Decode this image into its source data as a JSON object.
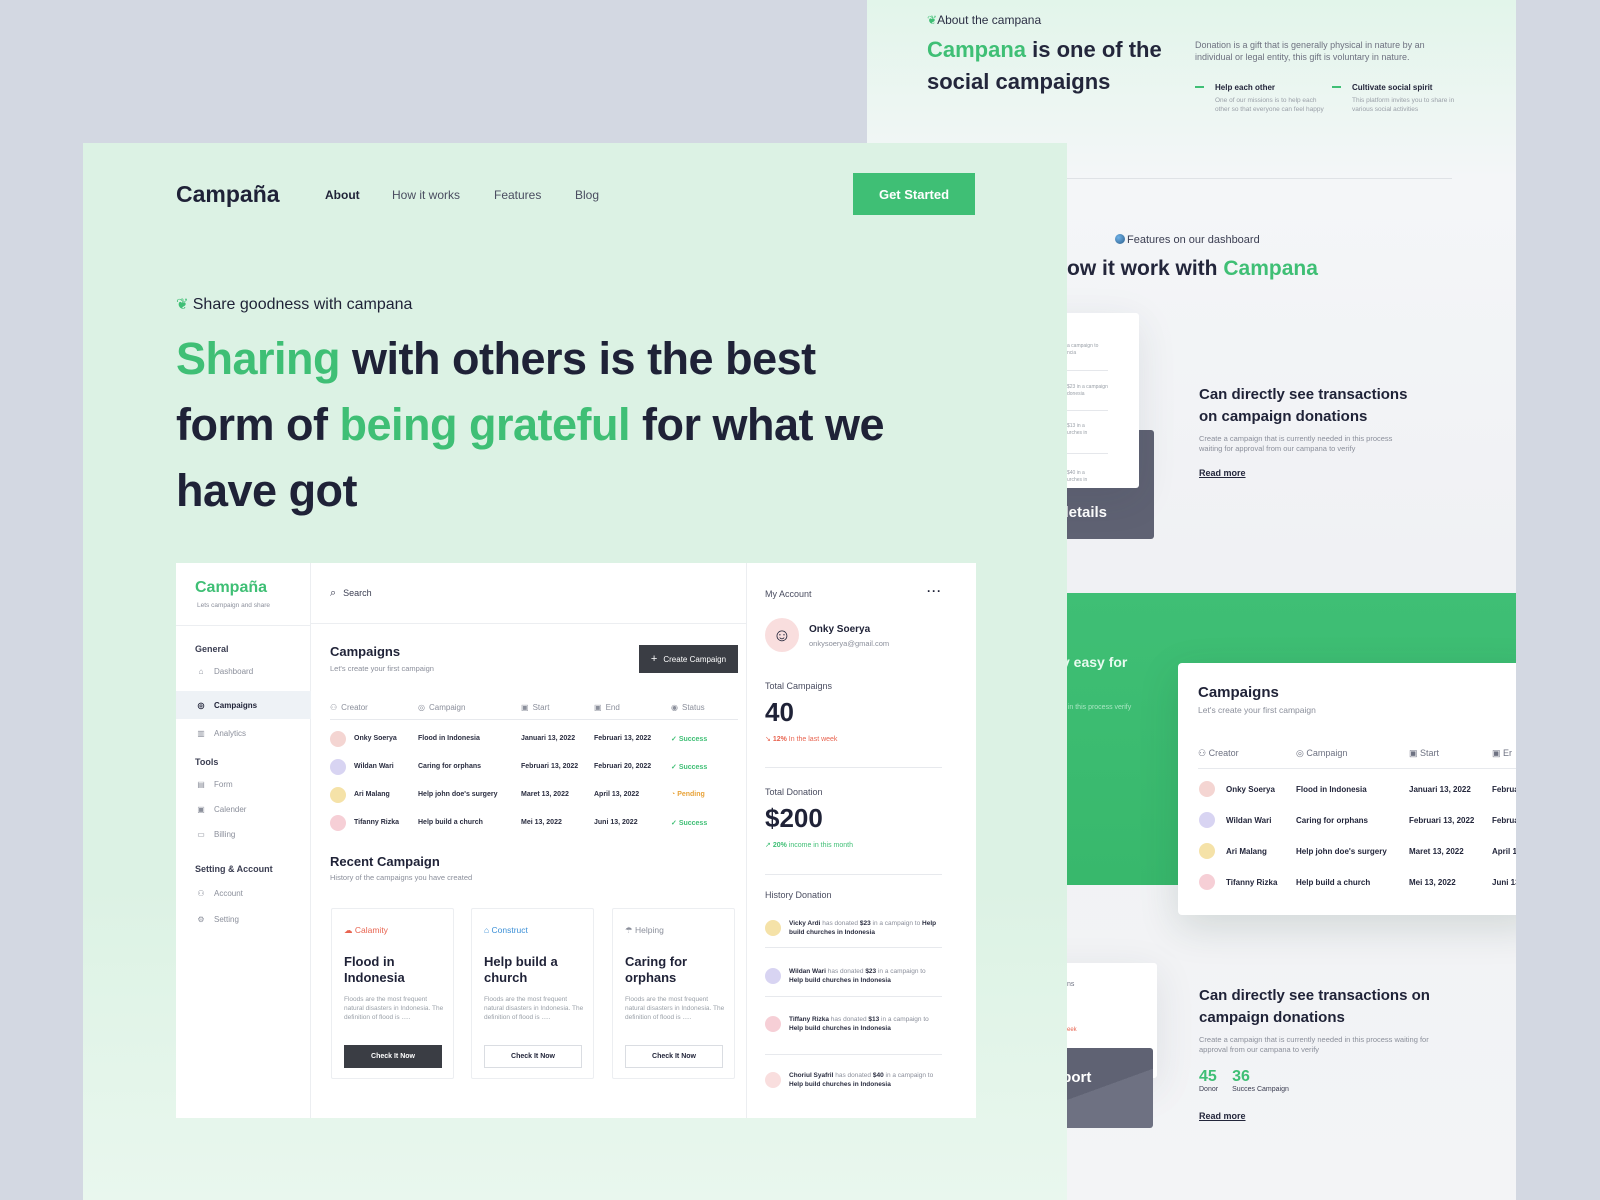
{
  "back": {
    "about_tag": "About the campana",
    "about_title_brand": "Campana",
    "about_title_rest": " is one of the social campaigns",
    "about_desc": "Donation is a gift that is generally physical in nature by an individual or legal entity, this gift is voluntary in nature.",
    "features": [
      {
        "title": "Help each other",
        "desc": "One of our missions is to help each other so that everyone can feel happy"
      },
      {
        "title": "Cultivate social spirit",
        "desc": "This platform invites you to share in various social activities"
      }
    ],
    "dashboard_tag": "Features on our dashboard",
    "dashboard_title_a": "ow it work with ",
    "dashboard_title_brand": "Campana",
    "dark_card_1": "on details",
    "mini_lines": [
      "a campaign to",
      "ncia",
      "$23 in a campaign",
      "donesia",
      "$13 in a",
      "urches in",
      "$40 in a",
      "urches in"
    ],
    "section1": {
      "title": "Can directly see transactions on campaign donations",
      "desc": "Create a campaign that is currently needed in this process waiting for approval from our campana to verify",
      "readmore": "Read more"
    },
    "band_text": "y easy for",
    "band_sub": "d in this process verify",
    "campaigns": {
      "title": "Campaigns",
      "sub": "Let's create your first campaign",
      "headers": [
        "Creator",
        "Campaign",
        "Start",
        "Er"
      ],
      "rows": [
        {
          "creator": "Onky Soerya",
          "campaign": "Flood in Indonesia",
          "start": "Januari 13, 2022",
          "end": "Februa"
        },
        {
          "creator": "Wildan Wari",
          "campaign": "Caring for orphans",
          "start": "Februari 13, 2022",
          "end": "Februa"
        },
        {
          "creator": "Ari Malang",
          "campaign": "Help john doe's surgery",
          "start": "Maret 13, 2022",
          "end": "April 1"
        },
        {
          "creator": "Tifanny Rizka",
          "campaign": "Help build a church",
          "start": "Mei 13, 2022",
          "end": "Juni 13"
        }
      ]
    },
    "report_card": "Report",
    "report_peek_1": "ns",
    "report_peek_2": "eek",
    "section2": {
      "title": "Can directly see transactions on campaign donations",
      "desc": "Create a campaign that is currently needed in this process waiting for approval from our campana to verify",
      "stat1_value": "45",
      "stat1_label": "Donor",
      "stat2_value": "36",
      "stat2_label": "Succes Campaign",
      "readmore": "Read more"
    }
  },
  "front": {
    "logo": "Campaña",
    "nav": [
      "About",
      "How it works",
      "Features",
      "Blog"
    ],
    "cta": "Get Started",
    "hero_tag": "Share goodness with campana",
    "hero": {
      "p1": "Sharing",
      "p2": " with others is the best form of ",
      "p3": "being grateful",
      "p4": " for what we have got"
    }
  },
  "dashboard": {
    "logo": "Campaña",
    "logo_sub": "Lets campaign and share",
    "groups": [
      {
        "title": "General",
        "items": [
          "Dashboard",
          "Campaigns",
          "Analytics"
        ]
      },
      {
        "title": "Tools",
        "items": [
          "Form",
          "Calender",
          "Billing"
        ]
      },
      {
        "title": "Setting & Account",
        "items": [
          "Account",
          "Setting"
        ]
      }
    ],
    "search_placeholder": "Search",
    "campaigns_title": "Campaigns",
    "campaigns_sub": "Let's create your first campaign",
    "create_button": "Create Campaign",
    "table_headers": [
      "Creator",
      "Campaign",
      "Start",
      "End",
      "Status"
    ],
    "rows": [
      {
        "creator": "Onky Soerya",
        "campaign": "Flood in Indonesia",
        "start": "Januari 13, 2022",
        "end": "Februari 13, 2022",
        "status": "Success"
      },
      {
        "creator": "Wildan Wari",
        "campaign": "Caring for orphans",
        "start": "Februari 13, 2022",
        "end": "Februari 20, 2022",
        "status": "Success"
      },
      {
        "creator": "Ari Malang",
        "campaign": "Help john doe's surgery",
        "start": "Maret 13, 2022",
        "end": "April 13, 2022",
        "status": "Pending"
      },
      {
        "creator": "Tifanny Rizka",
        "campaign": "Help build a church",
        "start": "Mei 13, 2022",
        "end": "Juni 13, 2022",
        "status": "Success"
      }
    ],
    "recent_title": "Recent Campaign",
    "recent_sub": "History of the campaigns you have created",
    "recent_cards": [
      {
        "category": "Calamity",
        "title": "Flood in Indonesia",
        "desc": "Floods are the most frequent natural disasters in Indonesia. The definition of flood is .....",
        "button": "Check It Now"
      },
      {
        "category": "Construct",
        "title": "Help build a church",
        "desc": "Floods are the most frequent natural disasters in Indonesia. The definition of flood is .....",
        "button": "Check It Now"
      },
      {
        "category": "Helping",
        "title": "Caring for orphans",
        "desc": "Floods are the most frequent natural disasters in Indonesia. The definition of flood is .....",
        "button": "Check It Now"
      }
    ],
    "account": {
      "label": "My Account",
      "name": "Onky Soerya",
      "email": "onkysoerya@gmail.com",
      "total_campaigns_label": "Total Campaigns",
      "total_campaigns": "40",
      "campaigns_change": "12%",
      "campaigns_change_text": "In the last week",
      "total_donation_label": "Total Donation",
      "total_donation": "$200",
      "donation_change": "20%",
      "donation_change_text": "income in this month",
      "history_label": "History Donation",
      "history": [
        {
          "name": "Vicky Ardi",
          "mid": " has donated ",
          "amount": "$23",
          "rest": " in a campaign to ",
          "campaign": "Help build churches in Indonesia"
        },
        {
          "name": "Wildan Wari",
          "mid": " has donated ",
          "amount": "$23",
          "rest": " in a campaign to ",
          "campaign": "Help build churches in Indonesia"
        },
        {
          "name": "Tiffany Rizka",
          "mid": " has donated ",
          "amount": "$13",
          "rest": " in a campaign to ",
          "campaign": "Help build churches in Indonesia"
        },
        {
          "name": "Choriul Syafril",
          "mid": " has donated ",
          "amount": "$40",
          "rest": " in a campaign to ",
          "campaign": "Help build churches in Indonesia"
        }
      ]
    }
  },
  "colors": {
    "brand": "#3fbf75",
    "dark": "#1f2237",
    "pending": "#e8a33a",
    "down": "#e8634f"
  }
}
